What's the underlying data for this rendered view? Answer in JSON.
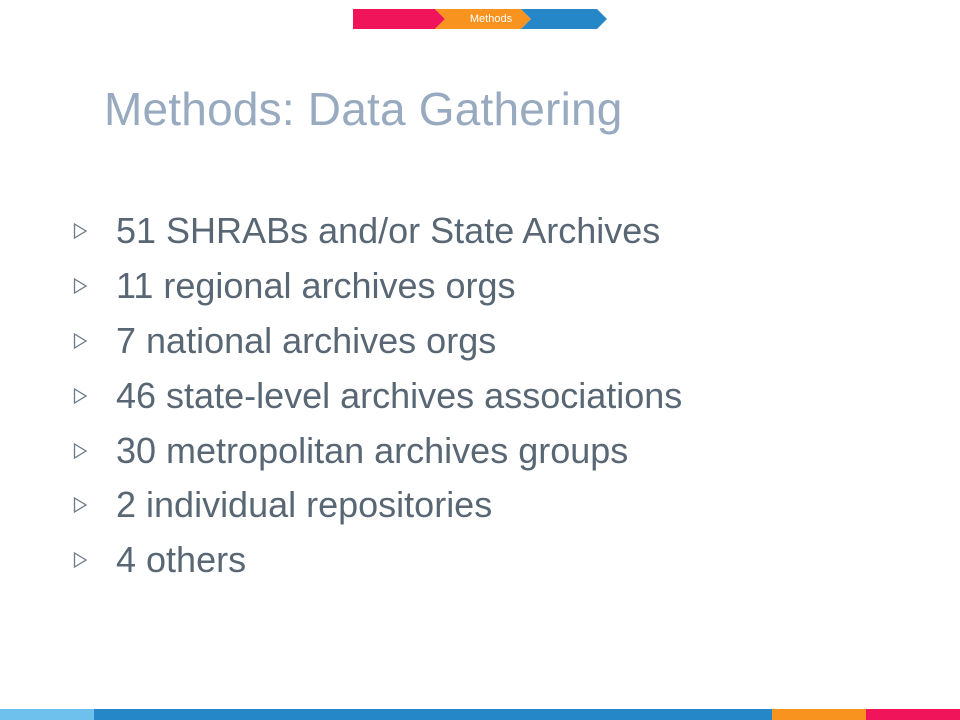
{
  "nav": {
    "label": "Methods",
    "colors": {
      "first": "#f0145a",
      "current": "#f7931e",
      "last": "#2587c8"
    }
  },
  "title": "Methods: Data Gathering",
  "bullets": [
    "51 SHRABs and/or State Archives",
    "11 regional archives orgs",
    "7 national archives orgs",
    "46 state-level archives associations",
    "30 metropolitan archives groups",
    "2 individual repositories",
    "4 others"
  ],
  "bullet_icon": "triangle-right-outline-icon",
  "colors": {
    "title": "#98aabf",
    "text": "#596775",
    "bullet": "#6b7a89",
    "footer": [
      "#6ec1ed",
      "#2587c8",
      "#f7931e",
      "#f0145a"
    ]
  }
}
